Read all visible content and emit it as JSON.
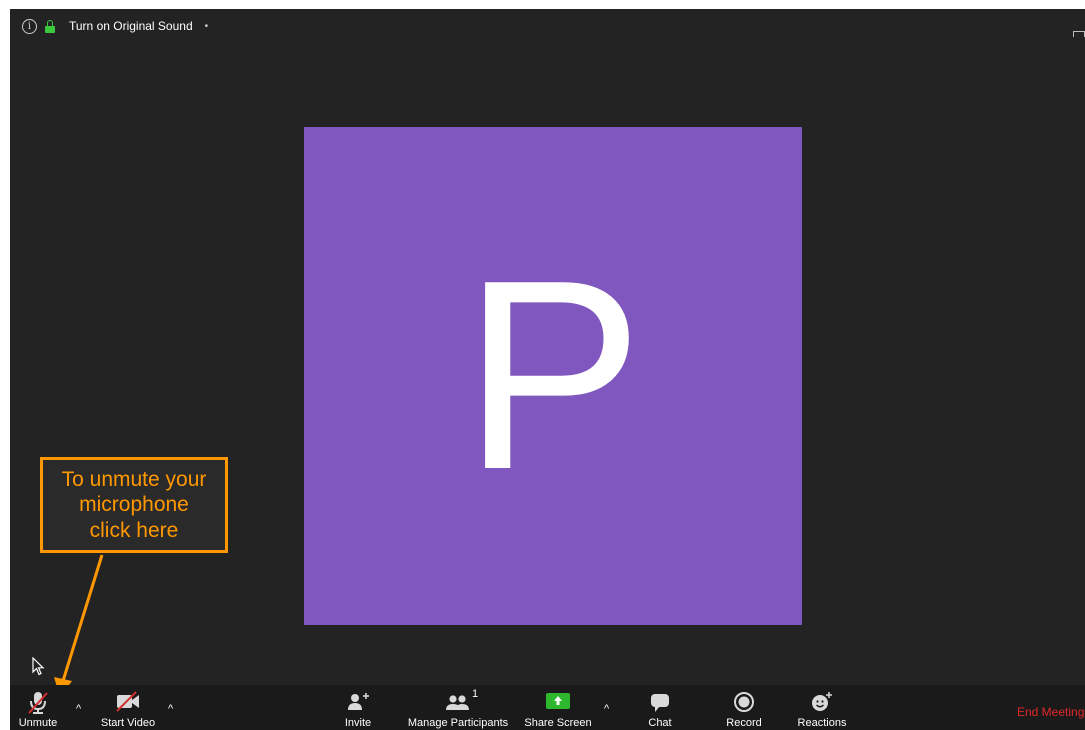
{
  "topbar": {
    "info_icon": "info-icon",
    "lock_icon": "lock-icon",
    "original_sound_label": "Turn on Original Sound",
    "dropdown_indicator": "•"
  },
  "participant": {
    "initial": "P",
    "avatar_color": "#7f57be"
  },
  "callout": {
    "text": "To unmute your\nmicrophone\nclick here",
    "color": "#ff9800"
  },
  "toolbar": {
    "unmute": "Unmute",
    "start_video": "Start Video",
    "invite": "Invite",
    "manage_participants": "Manage Participants",
    "participant_count": "1",
    "share_screen": "Share Screen",
    "chat": "Chat",
    "record": "Record",
    "reactions": "Reactions",
    "end_meeting": "End Meeting",
    "caret": "^"
  },
  "colors": {
    "background": "#232323",
    "toolbar": "#1a1a1a",
    "share_green": "#2db82d",
    "end_red": "#e02828",
    "muted_slash": "#d32f2f"
  }
}
